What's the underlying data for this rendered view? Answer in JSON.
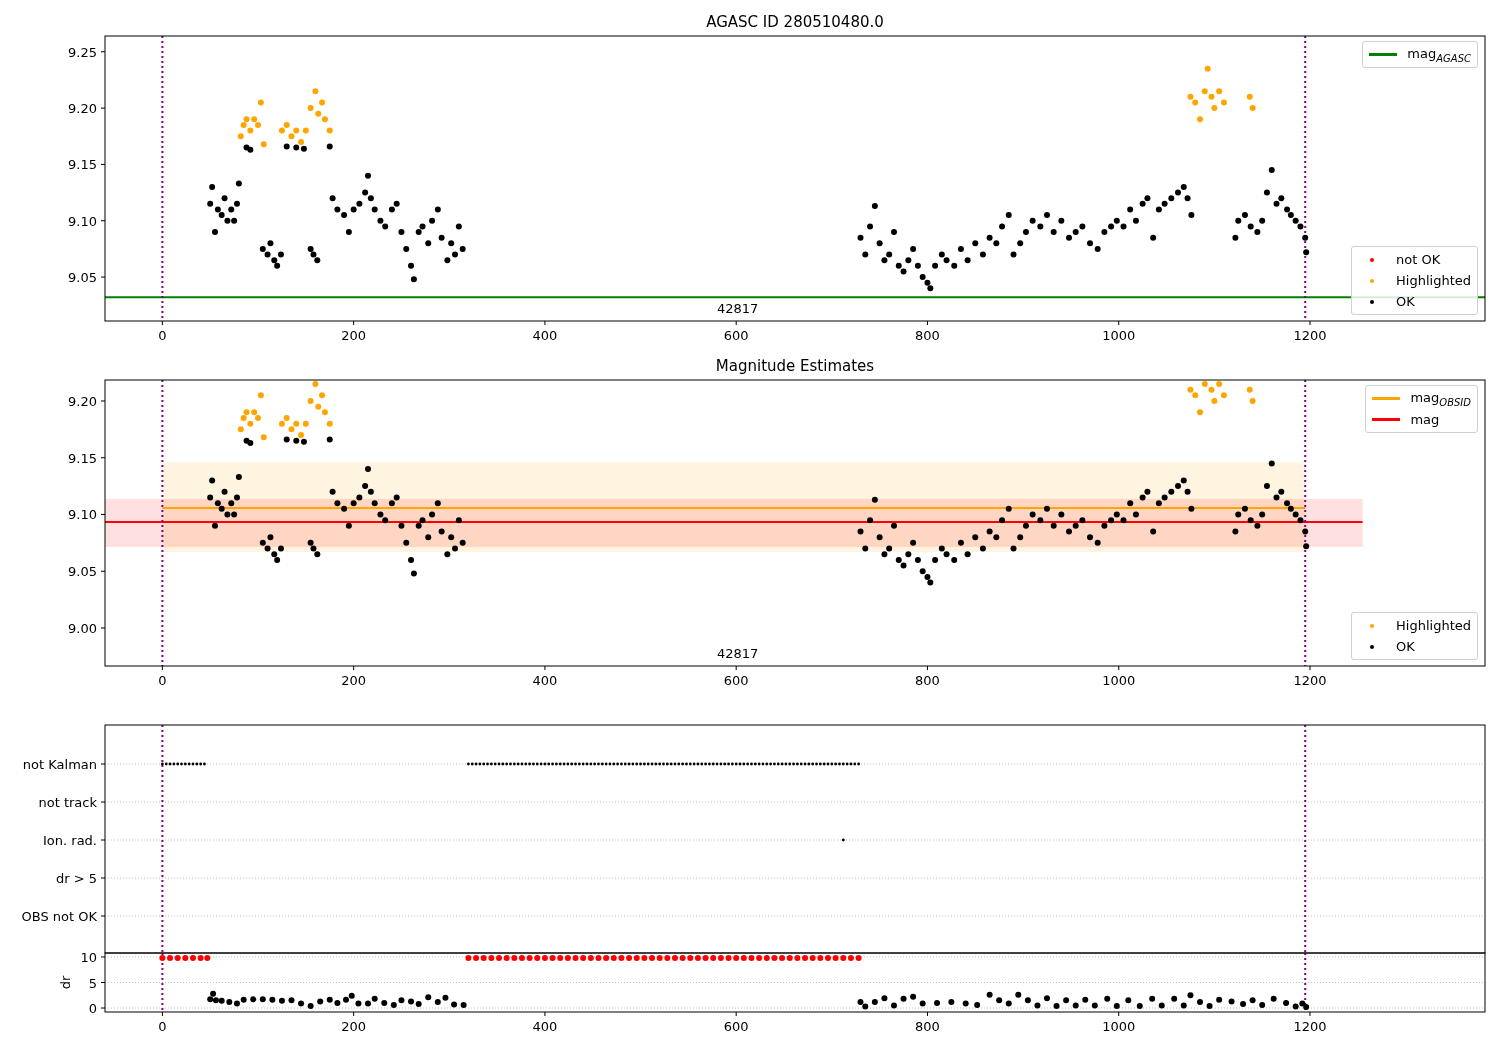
{
  "plots": [
    {
      "title": "AGASC ID 280510480.0",
      "legends": [
        {
          "items": [
            {
              "label": "mag$_{AGASC}$",
              "kind": "line",
              "color": "#008000"
            }
          ]
        },
        {
          "items": [
            {
              "label": "not OK",
              "kind": "marker",
              "color": "#ff0000"
            },
            {
              "label": "Highlighted",
              "kind": "marker",
              "color": "#ffa500"
            },
            {
              "label": "OK",
              "kind": "marker",
              "color": "#000000"
            }
          ]
        }
      ],
      "chart_data": {
        "type": "scatter",
        "ref_lines": [
          {
            "axis": "y",
            "value": 9.032,
            "color": "#008000"
          },
          {
            "axis": "x",
            "value": 0,
            "color": "#800080"
          },
          {
            "axis": "x",
            "value": 1195,
            "color": "#800080"
          }
        ],
        "xlim": [
          -60,
          1383
        ],
        "ylim": [
          9.011,
          9.264
        ],
        "xticks": [
          0,
          200,
          400,
          600,
          800,
          1000,
          1200
        ],
        "yticks": [
          {
            "value": 9.05,
            "label": "9.05"
          },
          {
            "value": 9.1,
            "label": "9.10"
          },
          {
            "value": 9.15,
            "label": "9.15"
          },
          {
            "value": 9.2,
            "label": "9.20"
          },
          {
            "value": 9.25,
            "label": "9.25"
          }
        ],
        "annotations": [
          "42817"
        ],
        "series": [
          {
            "color": "#ffa500",
            "x": [
              82,
              85,
              88,
              92,
              96,
              100,
              103,
              106,
              125,
              130,
              135,
              140,
              145,
              150,
              155,
              160,
              163,
              167,
              170,
              175,
              1075,
              1080,
              1085,
              1090,
              1093,
              1097,
              1100,
              1105,
              1110,
              1137,
              1140
            ],
            "values": [
              9.175,
              9.185,
              9.19,
              9.18,
              9.19,
              9.185,
              9.205,
              9.168,
              9.18,
              9.185,
              9.175,
              9.18,
              9.17,
              9.18,
              9.2,
              9.215,
              9.195,
              9.205,
              9.19,
              9.18,
              9.21,
              9.205,
              9.19,
              9.215,
              9.235,
              9.21,
              9.2,
              9.215,
              9.205,
              9.21,
              9.2
            ]
          },
          {
            "color": "#000000",
            "x": [
              50,
              52,
              55,
              58,
              62,
              65,
              68,
              72,
              75,
              78,
              80,
              88,
              92,
              105,
              110,
              113,
              117,
              120,
              124,
              130,
              140,
              148,
              155,
              158,
              162,
              175,
              178,
              183,
              190,
              195,
              200,
              206,
              212,
              215,
              218,
              222,
              228,
              233,
              240,
              245,
              250,
              255,
              260,
              263,
              268,
              272,
              278,
              282,
              288,
              292,
              298,
              302,
              306,
              310,
              314,
              730,
              735,
              740,
              745,
              750,
              755,
              760,
              765,
              770,
              775,
              780,
              785,
              790,
              795,
              800,
              803,
              808,
              815,
              820,
              828,
              835,
              842,
              850,
              858,
              865,
              872,
              878,
              885,
              890,
              897,
              903,
              910,
              918,
              925,
              932,
              940,
              948,
              955,
              962,
              970,
              978,
              985,
              992,
              998,
              1005,
              1012,
              1018,
              1025,
              1030,
              1036,
              1042,
              1048,
              1055,
              1062,
              1068,
              1072,
              1076,
              1122,
              1125,
              1132,
              1138,
              1145,
              1150,
              1155,
              1160,
              1165,
              1170,
              1176,
              1180,
              1185,
              1190,
              1195,
              1196
            ],
            "values": [
              9.115,
              9.13,
              9.09,
              9.11,
              9.105,
              9.12,
              9.1,
              9.11,
              9.1,
              9.115,
              9.133,
              9.165,
              9.163,
              9.075,
              9.07,
              9.08,
              9.065,
              9.06,
              9.07,
              9.166,
              9.165,
              9.164,
              9.075,
              9.07,
              9.065,
              9.166,
              9.12,
              9.11,
              9.105,
              9.09,
              9.11,
              9.115,
              9.125,
              9.14,
              9.12,
              9.11,
              9.1,
              9.095,
              9.11,
              9.115,
              9.09,
              9.075,
              9.06,
              9.048,
              9.09,
              9.095,
              9.08,
              9.1,
              9.11,
              9.085,
              9.065,
              9.08,
              9.07,
              9.095,
              9.075,
              9.085,
              9.07,
              9.095,
              9.113,
              9.08,
              9.065,
              9.07,
              9.09,
              9.06,
              9.055,
              9.065,
              9.075,
              9.06,
              9.05,
              9.045,
              9.04,
              9.06,
              9.07,
              9.065,
              9.06,
              9.075,
              9.065,
              9.08,
              9.07,
              9.085,
              9.08,
              9.095,
              9.105,
              9.07,
              9.08,
              9.09,
              9.1,
              9.095,
              9.105,
              9.09,
              9.1,
              9.085,
              9.09,
              9.095,
              9.08,
              9.075,
              9.09,
              9.095,
              9.1,
              9.095,
              9.11,
              9.1,
              9.115,
              9.12,
              9.085,
              9.11,
              9.115,
              9.12,
              9.125,
              9.13,
              9.12,
              9.105,
              9.085,
              9.1,
              9.105,
              9.095,
              9.09,
              9.1,
              9.125,
              9.145,
              9.115,
              9.12,
              9.11,
              9.105,
              9.1,
              9.095,
              9.085,
              9.072
            ]
          }
        ]
      }
    },
    {
      "title": "Magnitude Estimates",
      "legends": [
        {
          "items": [
            {
              "label": "mag$_{OBSID}$",
              "kind": "line",
              "color": "#ffa500"
            },
            {
              "label": "mag",
              "kind": "line",
              "color": "#ff0000"
            }
          ]
        },
        {
          "items": [
            {
              "label": "Highlighted",
              "kind": "marker",
              "color": "#ffa500"
            },
            {
              "label": "OK",
              "kind": "marker",
              "color": "#000000"
            }
          ]
        }
      ],
      "chart_data": {
        "type": "scatter",
        "bands": [
          {
            "axis": "y",
            "from": 9.067,
            "to": 9.146,
            "color": "#fff4e0"
          },
          {
            "axis": "y",
            "from": 9.0714,
            "to": 9.1137,
            "color": "#ffe0e0"
          }
        ],
        "ref_lines": [
          {
            "axis": "y",
            "value": 9.1057,
            "color": "#ffa500"
          },
          {
            "axis": "y",
            "value": 9.0934,
            "color": "#ff0000"
          },
          {
            "axis": "x",
            "value": 0,
            "color": "#800080"
          },
          {
            "axis": "x",
            "value": 1195,
            "color": "#800080"
          }
        ],
        "xlim": [
          -60,
          1383
        ],
        "ylim": [
          8.9665,
          9.2185
        ],
        "xticks": [
          0,
          200,
          400,
          600,
          800,
          1000,
          1200
        ],
        "yticks": [
          {
            "value": 9.0,
            "label": "9.00"
          },
          {
            "value": 9.05,
            "label": "9.05"
          },
          {
            "value": 9.1,
            "label": "9.10"
          },
          {
            "value": 9.15,
            "label": "9.15"
          },
          {
            "value": 9.2,
            "label": "9.20"
          }
        ],
        "annotations": [
          "42817"
        ],
        "series": [
          {
            "color": "#ffa500",
            "x": [
              82,
              85,
              88,
              92,
              96,
              100,
              103,
              106,
              125,
              130,
              135,
              140,
              145,
              150,
              155,
              160,
              163,
              167,
              170,
              175,
              1075,
              1080,
              1085,
              1090,
              1097,
              1100,
              1105,
              1110,
              1137,
              1140
            ],
            "values": [
              9.175,
              9.185,
              9.19,
              9.18,
              9.19,
              9.185,
              9.205,
              9.168,
              9.18,
              9.185,
              9.175,
              9.18,
              9.17,
              9.18,
              9.2,
              9.215,
              9.195,
              9.205,
              9.19,
              9.18,
              9.21,
              9.205,
              9.19,
              9.215,
              9.21,
              9.2,
              9.215,
              9.205,
              9.21,
              9.2
            ]
          },
          {
            "color": "#000000",
            "x": [
              50,
              52,
              55,
              58,
              62,
              65,
              68,
              72,
              75,
              78,
              80,
              88,
              92,
              105,
              110,
              113,
              117,
              120,
              124,
              130,
              140,
              148,
              155,
              158,
              162,
              175,
              178,
              183,
              190,
              195,
              200,
              206,
              212,
              215,
              218,
              222,
              228,
              233,
              240,
              245,
              250,
              255,
              260,
              263,
              268,
              272,
              278,
              282,
              288,
              292,
              298,
              302,
              306,
              310,
              314,
              730,
              735,
              740,
              745,
              750,
              755,
              760,
              765,
              770,
              775,
              780,
              785,
              790,
              795,
              800,
              803,
              808,
              815,
              820,
              828,
              835,
              842,
              850,
              858,
              865,
              872,
              878,
              885,
              890,
              897,
              903,
              910,
              918,
              925,
              932,
              940,
              948,
              955,
              962,
              970,
              978,
              985,
              992,
              998,
              1005,
              1012,
              1018,
              1025,
              1030,
              1036,
              1042,
              1048,
              1055,
              1062,
              1068,
              1072,
              1076,
              1122,
              1125,
              1132,
              1138,
              1145,
              1150,
              1155,
              1160,
              1165,
              1170,
              1176,
              1180,
              1185,
              1190,
              1195,
              1196
            ],
            "values": [
              9.115,
              9.13,
              9.09,
              9.11,
              9.105,
              9.12,
              9.1,
              9.11,
              9.1,
              9.115,
              9.133,
              9.165,
              9.163,
              9.075,
              9.07,
              9.08,
              9.065,
              9.06,
              9.07,
              9.166,
              9.165,
              9.164,
              9.075,
              9.07,
              9.065,
              9.166,
              9.12,
              9.11,
              9.105,
              9.09,
              9.11,
              9.115,
              9.125,
              9.14,
              9.12,
              9.11,
              9.1,
              9.095,
              9.11,
              9.115,
              9.09,
              9.075,
              9.06,
              9.048,
              9.09,
              9.095,
              9.08,
              9.1,
              9.11,
              9.085,
              9.065,
              9.08,
              9.07,
              9.095,
              9.075,
              9.085,
              9.07,
              9.095,
              9.113,
              9.08,
              9.065,
              9.07,
              9.09,
              9.06,
              9.055,
              9.065,
              9.075,
              9.06,
              9.05,
              9.045,
              9.04,
              9.06,
              9.07,
              9.065,
              9.06,
              9.075,
              9.065,
              9.08,
              9.07,
              9.085,
              9.08,
              9.095,
              9.105,
              9.07,
              9.08,
              9.09,
              9.1,
              9.095,
              9.105,
              9.09,
              9.1,
              9.085,
              9.09,
              9.095,
              9.08,
              9.075,
              9.09,
              9.095,
              9.1,
              9.095,
              9.11,
              9.1,
              9.115,
              9.12,
              9.085,
              9.11,
              9.115,
              9.12,
              9.125,
              9.13,
              9.12,
              9.105,
              9.085,
              9.1,
              9.105,
              9.095,
              9.09,
              9.1,
              9.125,
              9.145,
              9.115,
              9.12,
              9.11,
              9.105,
              9.1,
              9.095,
              9.085,
              9.072
            ]
          }
        ]
      }
    },
    {
      "flag_labels": [
        "not Kalman",
        "not track",
        "Ion. rad.",
        "dr > 5",
        "OBS not OK"
      ]
    },
    {
      "chart_data": {
        "type": "scatter",
        "ylabel": "dr",
        "grid": true,
        "ref_lines": [
          {
            "axis": "x",
            "value": 0,
            "color": "#800080"
          },
          {
            "axis": "x",
            "value": 1195,
            "color": "#800080"
          }
        ],
        "xlim": [
          -60,
          1383
        ],
        "ylim": [
          -0.78,
          10.78
        ],
        "xticks": [
          0,
          200,
          400,
          600,
          800,
          1000,
          1200
        ],
        "yticks": [
          0,
          5,
          10
        ],
        "series": [
          {
            "color": "#ff0000",
            "x": [
              0,
              8,
              16,
              24,
              32,
              40,
              47,
              320,
              328,
              336,
              344,
              352,
              360,
              368,
              376,
              384,
              392,
              400,
              408,
              416,
              424,
              432,
              440,
              448,
              456,
              464,
              472,
              480,
              488,
              496,
              504,
              512,
              520,
              528,
              536,
              544,
              552,
              560,
              568,
              576,
              584,
              592,
              600,
              608,
              616,
              624,
              632,
              640,
              648,
              656,
              664,
              672,
              680,
              688,
              696,
              704,
              712,
              720,
              728
            ],
            "values": [
              9.8,
              9.8,
              9.8,
              9.8,
              9.8,
              9.8,
              9.8,
              9.8,
              9.8,
              9.8,
              9.8,
              9.8,
              9.8,
              9.8,
              9.8,
              9.8,
              9.8,
              9.8,
              9.8,
              9.8,
              9.8,
              9.8,
              9.8,
              9.8,
              9.8,
              9.8,
              9.8,
              9.8,
              9.8,
              9.8,
              9.8,
              9.8,
              9.8,
              9.8,
              9.8,
              9.8,
              9.8,
              9.8,
              9.8,
              9.8,
              9.8,
              9.8,
              9.8,
              9.8,
              9.8,
              9.8,
              9.8,
              9.8,
              9.8,
              9.8,
              9.8,
              9.8,
              9.8,
              9.8,
              9.8,
              9.8,
              9.8,
              9.8,
              9.8
            ]
          },
          {
            "color": "#000000",
            "x": [
              50,
              53,
              56,
              62,
              70,
              78,
              85,
              95,
              105,
              115,
              125,
              135,
              145,
              155,
              165,
              175,
              183,
              192,
              198,
              205,
              215,
              222,
              232,
              242,
              250,
              260,
              268,
              278,
              288,
              296,
              305,
              315,
              730,
              735,
              745,
              755,
              765,
              775,
              785,
              795,
              810,
              825,
              840,
              852,
              865,
              875,
              885,
              895,
              905,
              915,
              925,
              935,
              945,
              955,
              965,
              975,
              988,
              998,
              1010,
              1022,
              1035,
              1045,
              1058,
              1068,
              1075,
              1085,
              1095,
              1105,
              1118,
              1130,
              1140,
              1150,
              1162,
              1175,
              1185,
              1192,
              1196
            ],
            "values": [
              1.7,
              2.8,
              1.5,
              1.4,
              1.2,
              0.9,
              1.6,
              1.7,
              1.7,
              1.6,
              1.4,
              1.5,
              0.9,
              0.4,
              1.3,
              1.6,
              1.0,
              1.6,
              2.4,
              0.9,
              0.9,
              1.8,
              1.0,
              0.6,
              1.5,
              1.3,
              0.8,
              2.1,
              1.2,
              2.0,
              0.7,
              0.6,
              1.2,
              0.3,
              1.2,
              1.9,
              0.5,
              1.8,
              2.2,
              0.9,
              1.0,
              1.2,
              0.9,
              0.6,
              2.6,
              1.5,
              0.9,
              2.6,
              1.5,
              0.5,
              1.9,
              0.4,
              1.5,
              0.5,
              1.6,
              0.5,
              1.8,
              0.4,
              1.5,
              0.4,
              1.8,
              0.5,
              1.8,
              0.5,
              2.5,
              1.2,
              0.4,
              1.6,
              1.3,
              0.8,
              1.5,
              0.6,
              1.8,
              1.0,
              0.3,
              0.9,
              0.2
            ]
          }
        ]
      }
    }
  ]
}
